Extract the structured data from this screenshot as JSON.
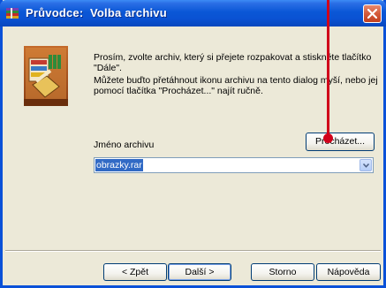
{
  "window": {
    "title": "Průvodce:  Volba archivu",
    "title_icon": "winrar-books-icon",
    "close_icon": "close-icon"
  },
  "wizard": {
    "image_icon": "winrar-wizard-illustration",
    "description_line1": "Prosím, zvolte archiv, který si přejete rozpakovat a stiskněte tlačítko \"Dále\".",
    "description_line2": "Můžete buďto přetáhnout ikonu archivu na tento dialog myší, nebo jej pomocí tlačítka \"Procházet...\" najít ručně."
  },
  "archive": {
    "label": "Jméno archivu",
    "browse_label": "Procházet...",
    "value": "obrazky.rar"
  },
  "buttons": {
    "back": "< Zpět",
    "next": "Další >",
    "cancel": "Storno",
    "help": "Nápověda"
  },
  "colors": {
    "title_bar": "#0a57d6",
    "annotation": "#d0021b",
    "selection": "#316ac5"
  }
}
